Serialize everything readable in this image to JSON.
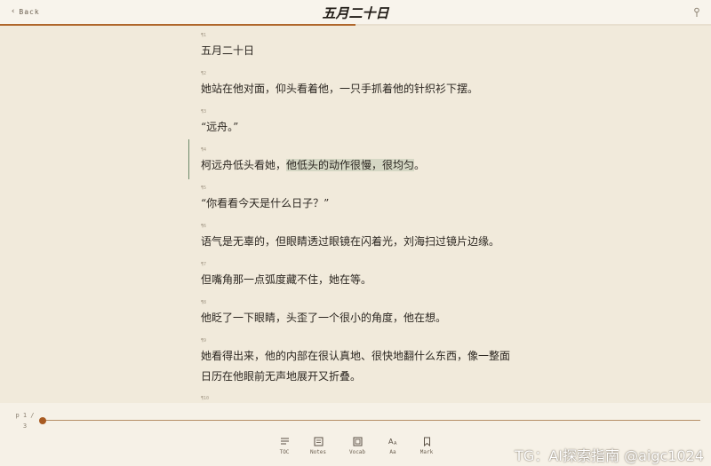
{
  "header": {
    "back_label": "Back",
    "title": "五月二十日",
    "progress_fraction": 0.5
  },
  "paragraphs": [
    {
      "num": "¶1",
      "text": "五月二十日"
    },
    {
      "num": "¶2",
      "text": "她站在他对面，仰头看着他，一只手抓着他的针织衫下摆。"
    },
    {
      "num": "¶3",
      "text": "“远舟。”"
    },
    {
      "num": "¶4",
      "text_before": "柯远舟低头看她，",
      "text_highlight": "他低头的动作很慢，很均匀",
      "text_after": "。"
    },
    {
      "num": "¶5",
      "text": "“你看看今天是什么日子？”"
    },
    {
      "num": "¶6",
      "text": "语气是无辜的，但眼睛透过眼镜在闪着光，刘海扫过镜片边缘。"
    },
    {
      "num": "¶7",
      "text": "但嘴角那一点弧度藏不住，她在等。"
    },
    {
      "num": "¶8",
      "text": "他眨了一下眼睛，头歪了一个很小的角度，他在想。"
    },
    {
      "num": "¶9",
      "lines": [
        "她看得出来，他的内部在很认真地、很快地翻什么东西，像一整面",
        "日历在他眼前无声地展开又折叠。"
      ]
    },
    {
      "num": "¶10",
      "text": ""
    }
  ],
  "footer": {
    "page_current": "p 1 /",
    "page_total": "3",
    "slider_fraction": 0.0,
    "tools": [
      {
        "label": "TOC",
        "icon": "toc-icon"
      },
      {
        "label": "Notes",
        "icon": "notes-icon"
      },
      {
        "label": "Vocab",
        "icon": "vocab-icon"
      },
      {
        "label": "Aa",
        "icon": "font-size-icon"
      },
      {
        "label": "Mark",
        "icon": "bookmark-icon"
      }
    ]
  },
  "watermark": "TG：AI探索指南 @aigc1024",
  "colors": {
    "accent": "#b0672b",
    "highlight": "#d5d7c4",
    "active_bar": "#6e8a6a",
    "background": "#f1eadb"
  }
}
